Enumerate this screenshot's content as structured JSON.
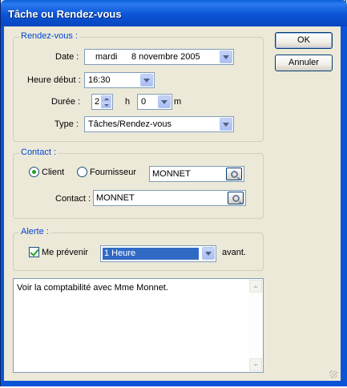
{
  "window": {
    "title": "Tâche ou Rendez-vous"
  },
  "rendezvous": {
    "legend": "Rendez-vous :",
    "date_label": "Date :",
    "date_day": "mardi",
    "date_value": "8 novembre 2005",
    "heure_label": "Heure début :",
    "heure_value": "16:30",
    "duree_label": "Durée :",
    "duree_hours": "2",
    "duree_h_unit": "h",
    "duree_minutes": "0",
    "duree_m_unit": "m",
    "type_label": "Type :",
    "type_value": "Tâches/Rendez-vous"
  },
  "contact": {
    "legend": "Contact :",
    "client_label": "Client",
    "fournisseur_label": "Fournisseur",
    "client_selected": true,
    "party_value": "MONNET",
    "contact_label": "Contact :",
    "contact_value": "MONNET"
  },
  "alerte": {
    "legend": "Alerte :",
    "prevenir_label": "Me prévenir",
    "prevenir_checked": true,
    "delay_value": "1 Heure",
    "after_label": "avant."
  },
  "notes": {
    "text": "Voir la comptabilité avec Mme Monnet."
  },
  "buttons": {
    "ok": "OK",
    "cancel": "Annuler"
  },
  "colors": {
    "titlebar": "#0b54d6",
    "group_legend": "#0046d5",
    "selection": "#316ac5"
  }
}
